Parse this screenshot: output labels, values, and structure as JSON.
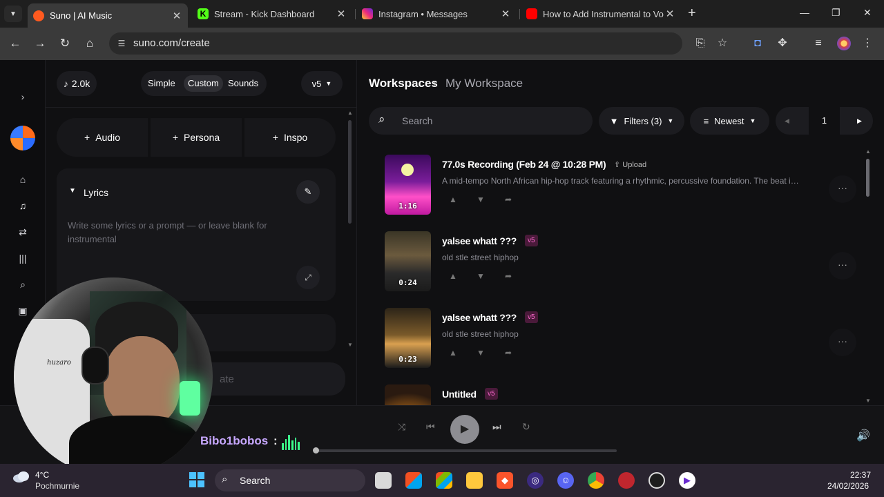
{
  "browser": {
    "tabs": [
      {
        "title": "Suno | AI Music",
        "favicon_color": "#ff5a1f"
      },
      {
        "title": "Stream - Kick Dashboard",
        "favicon_color": "#53fc18"
      },
      {
        "title": "Instagram • Messages",
        "favicon_color": "#e1306c"
      },
      {
        "title": "How to Add Instrumental to Vo",
        "favicon_color": "#ff0000"
      }
    ],
    "url": "suno.com/create"
  },
  "create": {
    "credits": "2.0k",
    "modes": [
      "Simple",
      "Custom",
      "Sounds"
    ],
    "active_mode": "Custom",
    "version": "v5",
    "add_buttons": [
      "Audio",
      "Persona",
      "Inspo"
    ],
    "lyrics_label": "Lyrics",
    "lyrics_placeholder": "Write some lyrics or a prompt — or leave blank for instrumental",
    "create_button_partial": "ate"
  },
  "overlay": {
    "chat_name": "Bibo1bobos",
    "chat_colon": ":",
    "brand_text": "huzaro"
  },
  "workspace": {
    "crumb_root": "Workspaces",
    "crumb_current": "My Workspace",
    "search_placeholder": "Search",
    "filters_label": "Filters (3)",
    "sort_label": "Newest",
    "page": "1",
    "songs": [
      {
        "title": "77.0s Recording (Feb 24 @ 10:28 PM)",
        "badge": "Upload",
        "badge_type": "upload",
        "description": "A mid-tempo North African hip-hop track featuring a rhythmic, percussive foundation. The beat is driv...",
        "duration": "1:16"
      },
      {
        "title": "yalsee whatt ???",
        "badge": "v5",
        "badge_type": "version",
        "description": "old stle street hiphop",
        "duration": "0:24"
      },
      {
        "title": "yalsee whatt ???",
        "badge": "v5",
        "badge_type": "version",
        "description": "old stle street hiphop",
        "duration": "0:23"
      },
      {
        "title": "Untitled",
        "badge": "v5",
        "badge_type": "version",
        "description": "",
        "duration": ""
      }
    ]
  },
  "taskbar": {
    "temperature": "4°C",
    "weather": "Pochmurnie",
    "search_label": "Search",
    "time": "22:37",
    "date": "24/02/2026"
  },
  "colors": {
    "accent_v5": "#ff6ad0",
    "chat_name": "#c8a8ff",
    "equalizer": "#3cff8a"
  }
}
